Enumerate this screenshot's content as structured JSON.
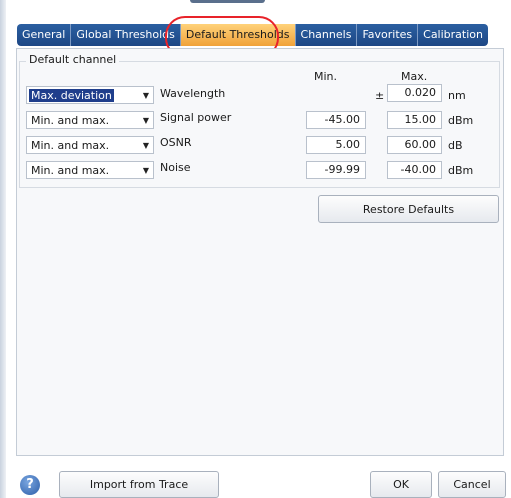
{
  "tabs": [
    {
      "label": "General"
    },
    {
      "label": "Global Thresholds"
    },
    {
      "label": "Default Thresholds"
    },
    {
      "label": "Channels"
    },
    {
      "label": "Favorites"
    },
    {
      "label": "Calibration"
    }
  ],
  "active_tab": "Default Thresholds",
  "group": {
    "title": "Default channel",
    "col_min": "Min.",
    "col_max": "Max.",
    "rows": [
      {
        "mode": "Max. deviation",
        "param": "Wavelength",
        "pm": "±",
        "min": "",
        "max": "0.020",
        "unit": "nm"
      },
      {
        "mode": "Min. and max.",
        "param": "Signal power",
        "min": "-45.00",
        "max": "15.00",
        "unit": "dBm"
      },
      {
        "mode": "Min. and max.",
        "param": "OSNR",
        "min": "5.00",
        "max": "60.00",
        "unit": "dB"
      },
      {
        "mode": "Min. and max.",
        "param": "Noise",
        "min": "-99.99",
        "max": "-40.00",
        "unit": "dBm"
      }
    ]
  },
  "buttons": {
    "restore": "Restore Defaults",
    "import": "Import from Trace",
    "ok": "OK",
    "cancel": "Cancel",
    "help": "?"
  },
  "colors": {
    "tab_bg": "#1d4785",
    "tab_active": "#f0a23a",
    "highlight": "#e8232a"
  }
}
